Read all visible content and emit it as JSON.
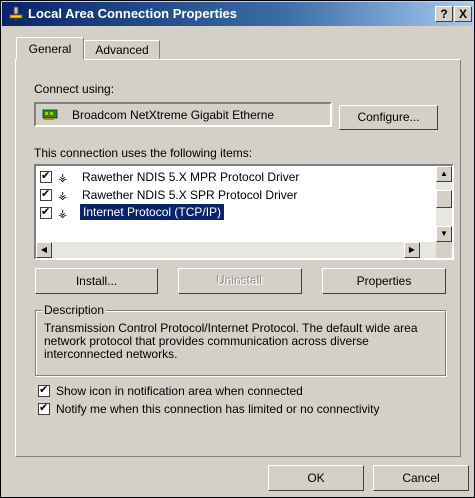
{
  "window": {
    "title": "Local Area Connection Properties",
    "help_label": "?",
    "close_label": "X",
    "colors": {
      "titlebar": "#0a246a",
      "face": "#d4d0c8",
      "selection": "#0a246a"
    }
  },
  "tabs": [
    {
      "label": "General"
    },
    {
      "label": "Advanced"
    }
  ],
  "general": {
    "connect_using_label": "Connect using:",
    "adapter_name": "Broadcom NetXtreme Gigabit Etherne",
    "configure_label": "Configure...",
    "items_label": "This connection uses the following items:",
    "items": [
      {
        "label": "Rawether NDIS 5.X MPR Protocol Driver",
        "checked": true
      },
      {
        "label": "Rawether NDIS 5.X SPR Protocol Driver",
        "checked": true
      },
      {
        "label": "Internet Protocol (TCP/IP)",
        "checked": true,
        "selected": true
      }
    ],
    "install_label": "Install...",
    "uninstall_label": "Uninstall",
    "properties_label": "Properties",
    "description_title": "Description",
    "description_text": "Transmission Control Protocol/Internet Protocol. The default wide area network protocol that provides communication across diverse interconnected networks.",
    "show_icon_label": "Show icon in notification area when connected",
    "notify_label": "Notify me when this connection has limited or no connectivity"
  },
  "footer": {
    "ok_label": "OK",
    "cancel_label": "Cancel"
  }
}
